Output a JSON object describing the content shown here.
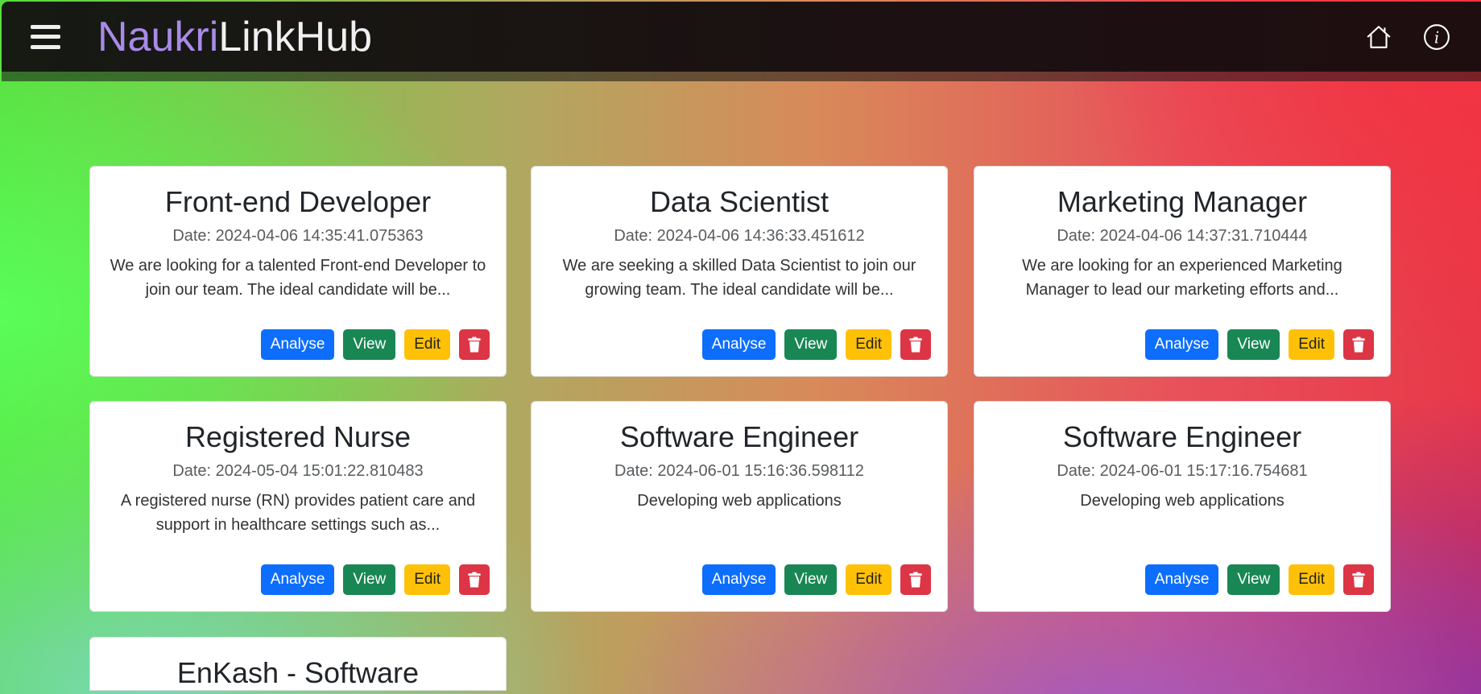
{
  "header": {
    "brand_part1": "Naukri",
    "brand_part2": "LinkHub",
    "icons": [
      "menu-icon",
      "home-icon",
      "info-icon"
    ]
  },
  "colors": {
    "brand_accent": "#a98ae8",
    "analyse": "#0d6efd",
    "view": "#198754",
    "edit": "#ffc107",
    "delete": "#dc3545"
  },
  "buttons": {
    "analyse": "Analyse",
    "view": "View",
    "edit": "Edit"
  },
  "jobs": [
    {
      "title": "Front-end Developer",
      "date": "Date: 2024-04-06 14:35:41.075363",
      "description": "We are looking for a talented Front-end Developer to join our team. The ideal candidate will be..."
    },
    {
      "title": "Data Scientist",
      "date": "Date: 2024-04-06 14:36:33.451612",
      "description": "We are seeking a skilled Data Scientist to join our growing team. The ideal candidate will be..."
    },
    {
      "title": "Marketing Manager",
      "date": "Date: 2024-04-06 14:37:31.710444",
      "description": "We are looking for an experienced Marketing Manager to lead our marketing efforts and..."
    },
    {
      "title": "Registered Nurse",
      "date": "Date: 2024-05-04 15:01:22.810483",
      "description": "A registered nurse (RN) provides patient care and support in healthcare settings such as..."
    },
    {
      "title": "Software Engineer",
      "date": "Date: 2024-06-01 15:16:36.598112",
      "description": "Developing web applications"
    },
    {
      "title": "Software Engineer",
      "date": "Date: 2024-06-01 15:17:16.754681",
      "description": "Developing web applications"
    },
    {
      "title": "EnKash - Software"
    }
  ]
}
